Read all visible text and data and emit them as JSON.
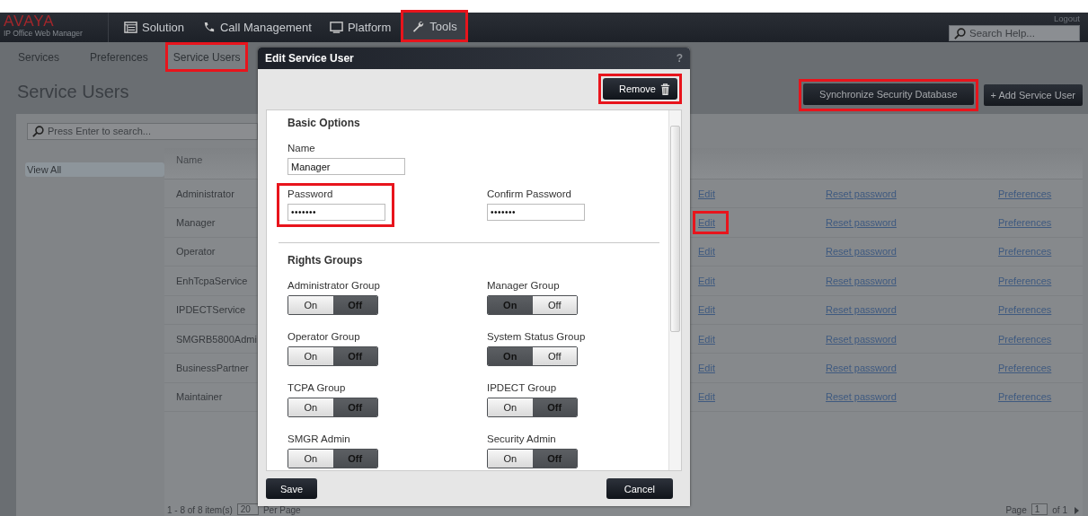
{
  "header": {
    "logo": "AVAYA",
    "product": "IP Office Web Manager",
    "nav": [
      {
        "label": "Solution",
        "kind": "grid",
        "highlighted": false
      },
      {
        "label": "Call Management",
        "kind": "phone",
        "highlighted": false
      },
      {
        "label": "Platform",
        "kind": "monitor",
        "highlighted": false
      },
      {
        "label": "Tools",
        "kind": "wrench",
        "highlighted": true
      }
    ],
    "logout": "Logout",
    "search": {
      "placeholder": "Search Help..."
    }
  },
  "subnav": {
    "tabs": [
      {
        "label": "Services",
        "selected": false,
        "highlighted": false
      },
      {
        "label": "Preferences",
        "selected": false,
        "highlighted": false
      },
      {
        "label": "Service Users",
        "selected": true,
        "highlighted": true
      }
    ]
  },
  "page": {
    "title": "Service Users",
    "actions": [
      {
        "label": "Synchronize Security Database",
        "highlighted": true
      },
      {
        "label": "+ Add Service User",
        "highlighted": false
      }
    ],
    "search": {
      "placeholder": "Press Enter to search..."
    },
    "sidebar": {
      "items": [
        {
          "label": "View All",
          "selected": true
        }
      ]
    },
    "table": {
      "columns": [
        "Name"
      ],
      "rows": [
        {
          "name": "Administrator",
          "edit": "Edit",
          "reset": "Reset password",
          "preferences": "Preferences",
          "edit_highlighted": false
        },
        {
          "name": "Manager",
          "edit": "Edit",
          "reset": "Reset password",
          "preferences": "Preferences",
          "edit_highlighted": true
        },
        {
          "name": "Operator",
          "edit": "Edit",
          "reset": "Reset password",
          "preferences": "Preferences",
          "edit_highlighted": false
        },
        {
          "name": "EnhTcpaService",
          "edit": "Edit",
          "reset": "Reset password",
          "preferences": "Preferences",
          "edit_highlighted": false
        },
        {
          "name": "IPDECTService",
          "edit": "Edit",
          "reset": "Reset password",
          "preferences": "Preferences",
          "edit_highlighted": false
        },
        {
          "name": "SMGRB5800Admi",
          "edit": "Edit",
          "reset": "Reset password",
          "preferences": "Preferences",
          "edit_highlighted": false
        },
        {
          "name": "BusinessPartner",
          "edit": "Edit",
          "reset": "Reset password",
          "preferences": "Preferences",
          "edit_highlighted": false
        },
        {
          "name": "Maintainer",
          "edit": "Edit",
          "reset": "Reset password",
          "preferences": "Preferences",
          "edit_highlighted": false
        }
      ]
    },
    "pager": {
      "summary": "1 - 8 of 8 item(s)",
      "per_page": "20",
      "per_page_label": "Per Page",
      "page_label": "Page",
      "page": "1",
      "of": "of 1"
    }
  },
  "dialog": {
    "title": "Edit Service User",
    "help": "?",
    "remove": {
      "label": "Remove",
      "highlighted": true
    },
    "basic_title": "Basic Options",
    "name": {
      "label": "Name",
      "value": "Manager"
    },
    "password": {
      "label": "Password",
      "value": "•••••••",
      "highlighted": true
    },
    "confirm": {
      "label": "Confirm Password",
      "value": "•••••••"
    },
    "rights_title": "Rights Groups",
    "rights_groups": [
      {
        "label": "Administrator Group",
        "on_label": "On",
        "off_label": "Off",
        "on": false
      },
      {
        "label": "Manager Group",
        "on_label": "On",
        "off_label": "Off",
        "on": true
      },
      {
        "label": "Operator Group",
        "on_label": "On",
        "off_label": "Off",
        "on": false
      },
      {
        "label": "System Status Group",
        "on_label": "On",
        "off_label": "Off",
        "on": true
      },
      {
        "label": "TCPA Group",
        "on_label": "On",
        "off_label": "Off",
        "on": false
      },
      {
        "label": "IPDECT Group",
        "on_label": "On",
        "off_label": "Off",
        "on": false
      },
      {
        "label": "SMGR Admin",
        "on_label": "On",
        "off_label": "Off",
        "on": false
      },
      {
        "label": "Security Admin",
        "on_label": "On",
        "off_label": "Off",
        "on": false
      }
    ],
    "save": "Save",
    "cancel": "Cancel"
  }
}
